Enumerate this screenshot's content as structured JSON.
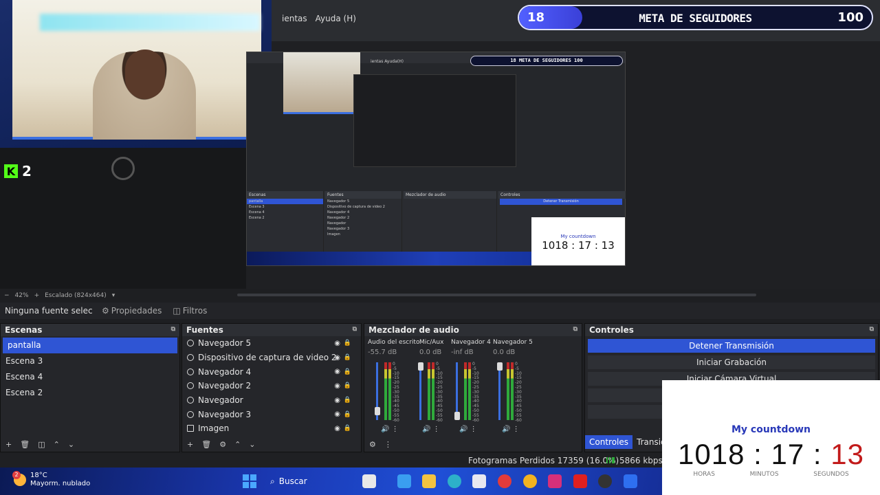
{
  "menu": [
    "ientas",
    "Ayuda (H)"
  ],
  "goal": {
    "current": "18",
    "title": "META DE SEGUIDORES",
    "max": "100",
    "progress": 0.18,
    "color": "#4a55f0"
  },
  "kick": {
    "count": "2",
    "logo": "K"
  },
  "nested": {
    "menu": "ientas  Ayuda(H)",
    "goal": "18      META DE SEGUIDORES      100",
    "scenes_header": "Escenas",
    "scenes": [
      "pantalla",
      "Escena 3",
      "Escena 4",
      "Escena 2"
    ],
    "sources_header": "Fuentes",
    "sources": [
      "Navegador 5",
      "Dispositivo de captura de video 2",
      "Navegador 4",
      "Navegador 2",
      "Navegador",
      "Navegador 3",
      "Imagen"
    ],
    "mixer_header": "Mezclador de audio",
    "controls_header": "Controles",
    "stop_stream": "Detener Transmisión",
    "countdown_title": "My countdown",
    "countdown_value": "1018 : 17 : 13"
  },
  "zoom": {
    "percent": "42%",
    "scale_label": "Escalado (824x464)"
  },
  "source_toolbar": {
    "no_source": "Ninguna fuente selec",
    "properties": "Propiedades",
    "filters": "Filtros"
  },
  "scenes": {
    "title": "Escenas",
    "items": [
      "pantalla",
      "Escena 3",
      "Escena 4",
      "Escena 2"
    ],
    "selected": 0
  },
  "sources": {
    "title": "Fuentes",
    "items": [
      {
        "name": "Navegador 5",
        "icon": "globe-icon"
      },
      {
        "name": "Dispositivo de captura de video 2",
        "icon": "camera-icon"
      },
      {
        "name": "Navegador 4",
        "icon": "globe-icon"
      },
      {
        "name": "Navegador 2",
        "icon": "globe-icon"
      },
      {
        "name": "Navegador",
        "icon": "globe-icon"
      },
      {
        "name": "Navegador 3",
        "icon": "globe-icon"
      },
      {
        "name": "Imagen",
        "icon": "image-icon"
      }
    ]
  },
  "mixer": {
    "title": "Mezclador de audio",
    "channels": [
      {
        "name": "Audio del escrito",
        "db": "-55.7 dB",
        "fader": 0.1
      },
      {
        "name": "Mic/Aux",
        "db": "0.0 dB",
        "fader": 1.0
      },
      {
        "name": "Navegador 4",
        "db": "-inf dB",
        "fader": 0.0
      },
      {
        "name": "Navegador 5",
        "db": "0.0 dB",
        "fader": 1.0
      }
    ],
    "scale": [
      "0",
      "-5",
      "-10",
      "-15",
      "-20",
      "-25",
      "-30",
      "-35",
      "-40",
      "-45",
      "-50",
      "-55",
      "-60"
    ]
  },
  "controls": {
    "title": "Controles",
    "buttons": [
      "Detener Transmisión",
      "Iniciar Grabación",
      "Iniciar Cámara Virtual",
      "",
      ""
    ],
    "tabs": [
      "Controles",
      "Transici"
    ]
  },
  "status": {
    "dropped": "Fotogramas Perdidos 17359 (16.0%)",
    "kbps": "5866 kbps"
  },
  "taskbar": {
    "weather_temp": "18°C",
    "weather_desc": "Mayorm. nublado",
    "notification_count": "2",
    "search": "Buscar"
  },
  "countdown": {
    "title": "My countdown",
    "hours": "1018",
    "minutes": "17",
    "seconds": "13",
    "sep": ":",
    "labels": [
      "HORAS",
      "MINUTOS",
      "SEGUNDOS"
    ]
  }
}
